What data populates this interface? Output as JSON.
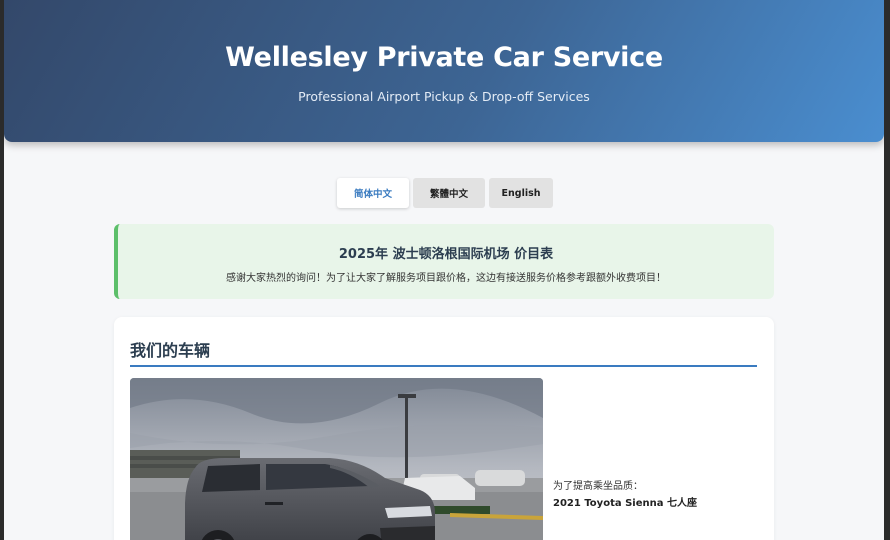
{
  "header": {
    "title": "Wellesley Private Car Service",
    "subtitle": "Professional Airport Pickup & Drop-off Services"
  },
  "languages": [
    {
      "label": "简体中文",
      "active": true
    },
    {
      "label": "繁體中文",
      "active": false
    },
    {
      "label": "English",
      "active": false
    }
  ],
  "notice": {
    "title": "2025年 波士顿洛根国际机场 价目表",
    "text": "感谢大家热烈的询问！为了让大家了解服务项目跟价格，这边有接送服务价格参考跟额外收费项目！"
  },
  "vehicles": {
    "heading": "我们的车辆",
    "intro": "为了提高乘坐品质：",
    "model": "2021 Toyota Sienna 七人座"
  },
  "colors": {
    "header_start": "#33486a",
    "header_end": "#4a8ed0",
    "accent": "#3a7bc0",
    "notice_bg": "#e8f5e9",
    "notice_border": "#5cbf6a"
  }
}
